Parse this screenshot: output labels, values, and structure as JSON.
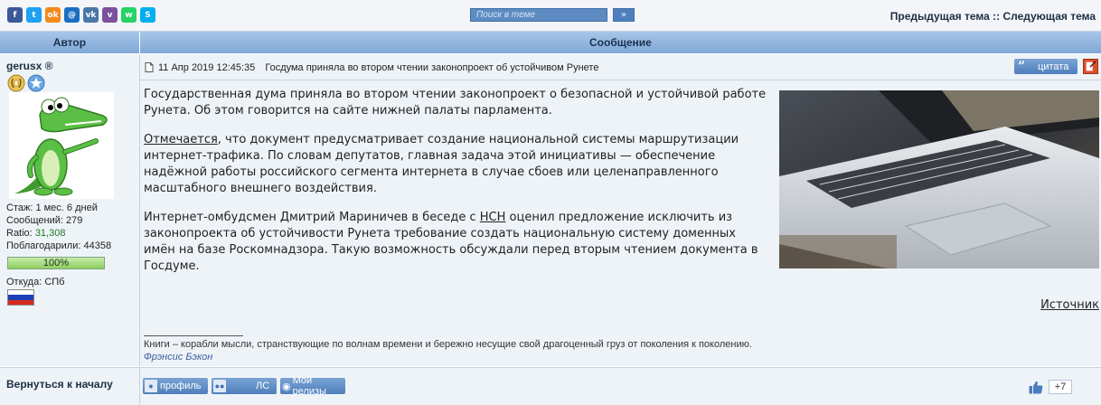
{
  "share_icons": [
    {
      "name": "facebook-icon",
      "glyph": "f",
      "color": "#3b5998"
    },
    {
      "name": "twitter-icon",
      "glyph": "t",
      "color": "#1da1f2"
    },
    {
      "name": "odnoklassniki-icon",
      "glyph": "ok",
      "color": "#f28a1b"
    },
    {
      "name": "moimir-icon",
      "glyph": "@",
      "color": "#1b6ec2"
    },
    {
      "name": "vkontakte-icon",
      "glyph": "vk",
      "color": "#4a76a8"
    },
    {
      "name": "viber-icon",
      "glyph": "v",
      "color": "#7b519d"
    },
    {
      "name": "whatsapp-icon",
      "glyph": "w",
      "color": "#25d366"
    },
    {
      "name": "skype-icon",
      "glyph": "S",
      "color": "#00aff0"
    }
  ],
  "search": {
    "placeholder": "Поиск в теме",
    "go_label": "»"
  },
  "topic_nav": {
    "prev": "Предыдущая тема",
    "separator": "::",
    "next": "Следующая тема"
  },
  "table_headers": {
    "author": "Автор",
    "message": "Сообщение"
  },
  "author": {
    "name": "gerusx ®",
    "tenure": "Стаж: 1 мес. 6 дней",
    "posts": "Сообщений: 279",
    "ratio_label": "Ratio:",
    "ratio_value": "31,308",
    "thanks": "Поблагодарили: 44358",
    "progress_percent": 100,
    "progress_label": "100%",
    "from": "Откуда: СПб"
  },
  "post": {
    "date": "11 Апр 2019 12:45:35",
    "title": "Госдума приняла во втором чтении законопроект об устойчивом Рунете",
    "quote_label": "цитата",
    "paragraphs": {
      "p1": "Государственная дума приняла во втором чтении законопроект о безопасной и устойчивой работе Рунета. Об этом говорится на сайте нижней палаты парламента.",
      "p2_link": "Отмечается",
      "p2_rest": ", что документ предусматривает создание национальной системы маршрутизации интернет-трафика. По словам депутатов, главная задача этой инициативы — обеспечение надёжной работы российского сегмента интернета в случае сбоев или целенаправленного масштабного внешнего воздействия.",
      "p3_start": "Интернет-омбудсмен Дмитрий Мариничев в беседе с ",
      "p3_link": "НСН",
      "p3_rest": " оценил предложение исключить из законопроекта об устойчивости Рунета требование создать национальную систему доменных имён на базе Роскомнадзора. Такую возможность обсуждали перед вторым чтением документа в Госдуме."
    },
    "source_link": "Источник",
    "signature_text": "Книги – корабли мысли, странствующие по волнам времени и бережно несущие свой драгоценный груз от поколения к поколению.",
    "signature_author": "Фрэнсис Бэкон"
  },
  "bottom": {
    "back_to_top": "Вернуться к началу",
    "profile_label": "профиль",
    "pm_label": "ЛС",
    "releases_label": "Мои релизы",
    "like_count": "+7"
  },
  "colors": {
    "header_blue": "#7fa7d6",
    "row_bg": "#eef3f8",
    "button_blue": "#4e7fbb",
    "ratio_green": "#1d7a1d"
  }
}
